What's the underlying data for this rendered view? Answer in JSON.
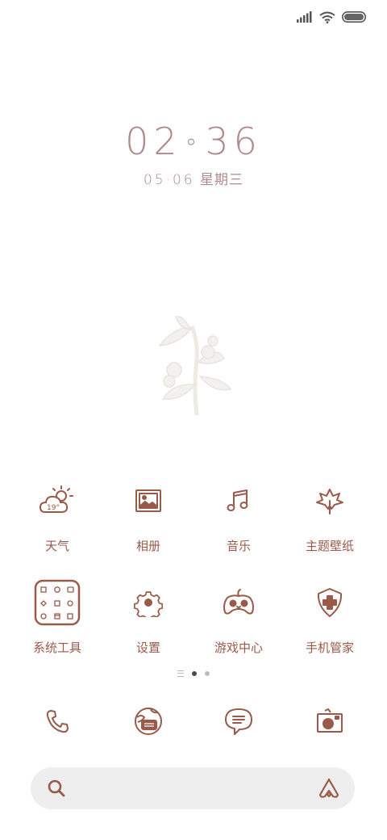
{
  "status_bar": {
    "signal_icon": "cellular-signal-icon",
    "wifi_icon": "wifi-icon",
    "battery_icon": "battery-icon"
  },
  "clock": {
    "hours": "02",
    "minutes": "36",
    "date_numeric": "05·06",
    "weekday": "星期三"
  },
  "apps": [
    {
      "label": "天气",
      "icon": "weather-icon",
      "temp": "19°"
    },
    {
      "label": "相册",
      "icon": "gallery-icon"
    },
    {
      "label": "音乐",
      "icon": "music-icon"
    },
    {
      "label": "主题壁纸",
      "icon": "themes-icon"
    },
    {
      "label": "系统工具",
      "icon": "system-tools-folder-icon"
    },
    {
      "label": "设置",
      "icon": "settings-icon"
    },
    {
      "label": "游戏中心",
      "icon": "game-center-icon"
    },
    {
      "label": "手机管家",
      "icon": "security-icon"
    }
  ],
  "page_indicator": {
    "pages": 2,
    "current": 1
  },
  "dock": [
    {
      "icon": "phone-icon"
    },
    {
      "icon": "browser-icon"
    },
    {
      "icon": "messages-icon"
    },
    {
      "icon": "camera-icon"
    }
  ],
  "search_bar": {
    "search_icon": "search-icon",
    "assistant_icon": "assistant-icon"
  },
  "colors": {
    "icon_brown": "#9a5a4a",
    "clock_color": "#b08a8a",
    "search_bg": "#eeeeee"
  }
}
